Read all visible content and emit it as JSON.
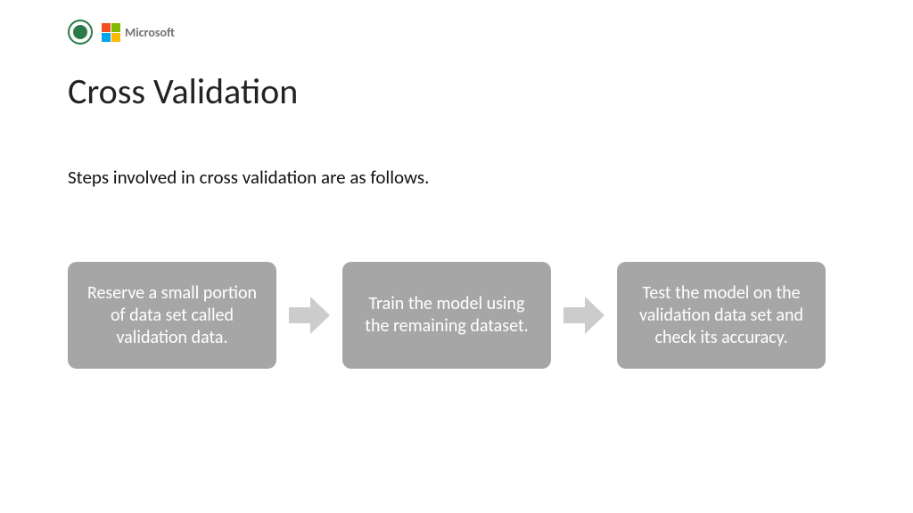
{
  "header": {
    "microsoft_label": "Microsoft"
  },
  "title": "Cross Validation",
  "subtitle": "Steps involved in cross validation are as follows.",
  "steps": {
    "s1": "Reserve a small portion of data set called validation data.",
    "s2": "Train the model using the remaining dataset.",
    "s3": "Test the model on the validation data set and check its accuracy."
  }
}
